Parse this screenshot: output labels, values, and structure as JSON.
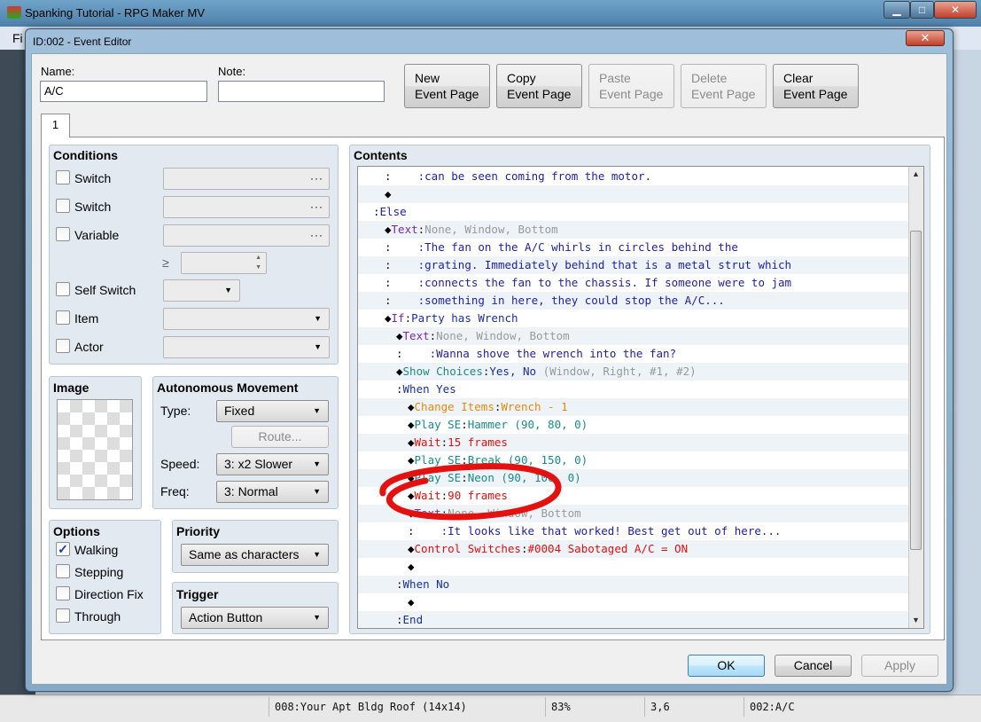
{
  "app": {
    "title": "Spanking Tutorial - RPG Maker MV",
    "menu_initial": "Fi"
  },
  "status": {
    "map": "008:Your Apt Bldg Roof (14x14)",
    "zoom": "83%",
    "coords": "3,6",
    "event": "002:A/C"
  },
  "dialog": {
    "title": "ID:002 - Event Editor",
    "name_label": "Name:",
    "name_value": "A/C",
    "note_label": "Note:",
    "note_value": "",
    "buttons": {
      "new_l1": "New",
      "new_l2": "Event Page",
      "copy_l1": "Copy",
      "copy_l2": "Event Page",
      "paste_l1": "Paste",
      "paste_l2": "Event Page",
      "delete_l1": "Delete",
      "delete_l2": "Event Page",
      "clear_l1": "Clear",
      "clear_l2": "Event Page"
    },
    "tab": "1",
    "ok": "OK",
    "cancel": "Cancel",
    "apply": "Apply"
  },
  "conditions": {
    "title": "Conditions",
    "switch1": "Switch",
    "switch2": "Switch",
    "variable": "Variable",
    "gte": "≥",
    "self_switch": "Self Switch",
    "item": "Item",
    "actor": "Actor",
    "dots": "···"
  },
  "image": {
    "title": "Image"
  },
  "movement": {
    "title": "Autonomous Movement",
    "type_label": "Type:",
    "type_value": "Fixed",
    "route": "Route...",
    "speed_label": "Speed:",
    "speed_value": "3: x2 Slower",
    "freq_label": "Freq:",
    "freq_value": "3: Normal"
  },
  "options": {
    "title": "Options",
    "walking": "Walking",
    "walking_checked": true,
    "stepping": "Stepping",
    "direction_fix": "Direction Fix",
    "through": "Through",
    "check": "✓"
  },
  "priority": {
    "title": "Priority",
    "value": "Same as characters"
  },
  "trigger": {
    "title": "Trigger",
    "value": "Action Button"
  },
  "contents": {
    "title": "Contents",
    "rows": [
      {
        "indent": 2,
        "segs": [
          {
            "t": ":",
            "c": "k-col"
          },
          {
            "t": "    :can be seen coming from the motor.",
            "c": "k-text"
          }
        ]
      },
      {
        "indent": 2,
        "segs": [
          {
            "t": "◆",
            "c": "diamond"
          }
        ]
      },
      {
        "indent": 1,
        "segs": [
          {
            "t": ":",
            "c": "k-col"
          },
          {
            "t": "Else",
            "c": "k-text"
          }
        ]
      },
      {
        "indent": 2,
        "segs": [
          {
            "t": "◆",
            "c": "diamond"
          },
          {
            "t": "Text",
            "c": "k-cmd"
          },
          {
            "t": ":",
            "c": "k-col"
          },
          {
            "t": "None, Window, Bottom",
            "c": "k-gray"
          }
        ]
      },
      {
        "indent": 2,
        "segs": [
          {
            "t": ":",
            "c": "k-col"
          },
          {
            "t": "    :The fan on the A/C whirls in circles behind the",
            "c": "k-text"
          }
        ]
      },
      {
        "indent": 2,
        "segs": [
          {
            "t": ":",
            "c": "k-col"
          },
          {
            "t": "    :grating. Immediately behind that is a metal strut which",
            "c": "k-text"
          }
        ]
      },
      {
        "indent": 2,
        "segs": [
          {
            "t": ":",
            "c": "k-col"
          },
          {
            "t": "    :connects the fan to the chassis. If someone were to jam",
            "c": "k-text"
          }
        ]
      },
      {
        "indent": 2,
        "segs": [
          {
            "t": ":",
            "c": "k-col"
          },
          {
            "t": "    :something in here, they could stop the A/C...",
            "c": "k-text"
          }
        ]
      },
      {
        "indent": 2,
        "segs": [
          {
            "t": "◆",
            "c": "diamond"
          },
          {
            "t": "If",
            "c": "k-cmd"
          },
          {
            "t": ":",
            "c": "k-col"
          },
          {
            "t": "Party has Wrench",
            "c": "k-navy"
          }
        ]
      },
      {
        "indent": 3,
        "segs": [
          {
            "t": "◆",
            "c": "diamond"
          },
          {
            "t": "Text",
            "c": "k-cmd"
          },
          {
            "t": ":",
            "c": "k-col"
          },
          {
            "t": "None, Window, Bottom",
            "c": "k-gray"
          }
        ]
      },
      {
        "indent": 3,
        "segs": [
          {
            "t": ":",
            "c": "k-col"
          },
          {
            "t": "    :Wanna shove the wrench into the fan?",
            "c": "k-text"
          }
        ]
      },
      {
        "indent": 3,
        "segs": [
          {
            "t": "◆",
            "c": "diamond"
          },
          {
            "t": "Show Choices",
            "c": "k-teal"
          },
          {
            "t": ":",
            "c": "k-col"
          },
          {
            "t": "Yes, No ",
            "c": "k-navy"
          },
          {
            "t": "(Window, Right, #1, #2)",
            "c": "k-gray"
          }
        ]
      },
      {
        "indent": 3,
        "segs": [
          {
            "t": ":",
            "c": "k-col"
          },
          {
            "t": "When Yes",
            "c": "k-navy"
          }
        ]
      },
      {
        "indent": 4,
        "segs": [
          {
            "t": "◆",
            "c": "diamond"
          },
          {
            "t": "Change Items",
            "c": "k-orange"
          },
          {
            "t": ":",
            "c": "k-col"
          },
          {
            "t": "Wrench - 1",
            "c": "k-orange"
          }
        ]
      },
      {
        "indent": 4,
        "segs": [
          {
            "t": "◆",
            "c": "diamond"
          },
          {
            "t": "Play SE",
            "c": "k-teal"
          },
          {
            "t": ":",
            "c": "k-col"
          },
          {
            "t": "Hammer (90, 80, 0)",
            "c": "k-teal"
          }
        ]
      },
      {
        "indent": 4,
        "segs": [
          {
            "t": "◆",
            "c": "diamond"
          },
          {
            "t": "Wait",
            "c": "k-red"
          },
          {
            "t": ":",
            "c": "k-col"
          },
          {
            "t": "15 frames",
            "c": "k-red"
          }
        ]
      },
      {
        "indent": 4,
        "segs": [
          {
            "t": "◆",
            "c": "diamond"
          },
          {
            "t": "Play SE",
            "c": "k-teal"
          },
          {
            "t": ":",
            "c": "k-col"
          },
          {
            "t": "Break (90, 150, 0)",
            "c": "k-teal"
          }
        ]
      },
      {
        "indent": 4,
        "segs": [
          {
            "t": "◆",
            "c": "diamond"
          },
          {
            "t": "Play SE",
            "c": "k-teal"
          },
          {
            "t": ":",
            "c": "k-col"
          },
          {
            "t": "Neon (90, 100, 0)",
            "c": "k-teal"
          }
        ]
      },
      {
        "indent": 4,
        "segs": [
          {
            "t": "◆",
            "c": "diamond"
          },
          {
            "t": "Wait",
            "c": "k-red"
          },
          {
            "t": ":",
            "c": "k-col"
          },
          {
            "t": "90 frames",
            "c": "k-red"
          }
        ]
      },
      {
        "indent": 4,
        "segs": [
          {
            "t": "◆",
            "c": "diamond"
          },
          {
            "t": "Text",
            "c": "k-cmd"
          },
          {
            "t": ":",
            "c": "k-col"
          },
          {
            "t": "None, Window, Bottom",
            "c": "k-gray"
          }
        ]
      },
      {
        "indent": 4,
        "segs": [
          {
            "t": ":",
            "c": "k-col"
          },
          {
            "t": "    :It looks like that worked! Best get out of here...",
            "c": "k-text"
          }
        ]
      },
      {
        "indent": 4,
        "segs": [
          {
            "t": "◆",
            "c": "diamond"
          },
          {
            "t": "Control Switches",
            "c": "k-red"
          },
          {
            "t": ":",
            "c": "k-col"
          },
          {
            "t": "#0004 Sabotaged A/C = ON",
            "c": "k-red"
          }
        ]
      },
      {
        "indent": 4,
        "segs": [
          {
            "t": "◆",
            "c": "diamond"
          }
        ]
      },
      {
        "indent": 3,
        "segs": [
          {
            "t": ":",
            "c": "k-col"
          },
          {
            "t": "When No",
            "c": "k-navy"
          }
        ]
      },
      {
        "indent": 4,
        "segs": [
          {
            "t": "◆",
            "c": "diamond"
          }
        ]
      },
      {
        "indent": 3,
        "segs": [
          {
            "t": ":",
            "c": "k-col"
          },
          {
            "t": "End",
            "c": "k-navy"
          }
        ]
      }
    ]
  },
  "icons": {
    "minimize": "minimize-icon",
    "maximize": "maximize-icon",
    "close": "close-icon",
    "dropdown": "chevron-down-icon"
  },
  "glyphs": {
    "down": "▼",
    "up": "▲",
    "close": "✕",
    "min": "▁",
    "max": "□",
    "spin_up": "▲",
    "spin_down": "▼"
  },
  "colors": {
    "annotation_circle": "#e41111"
  }
}
